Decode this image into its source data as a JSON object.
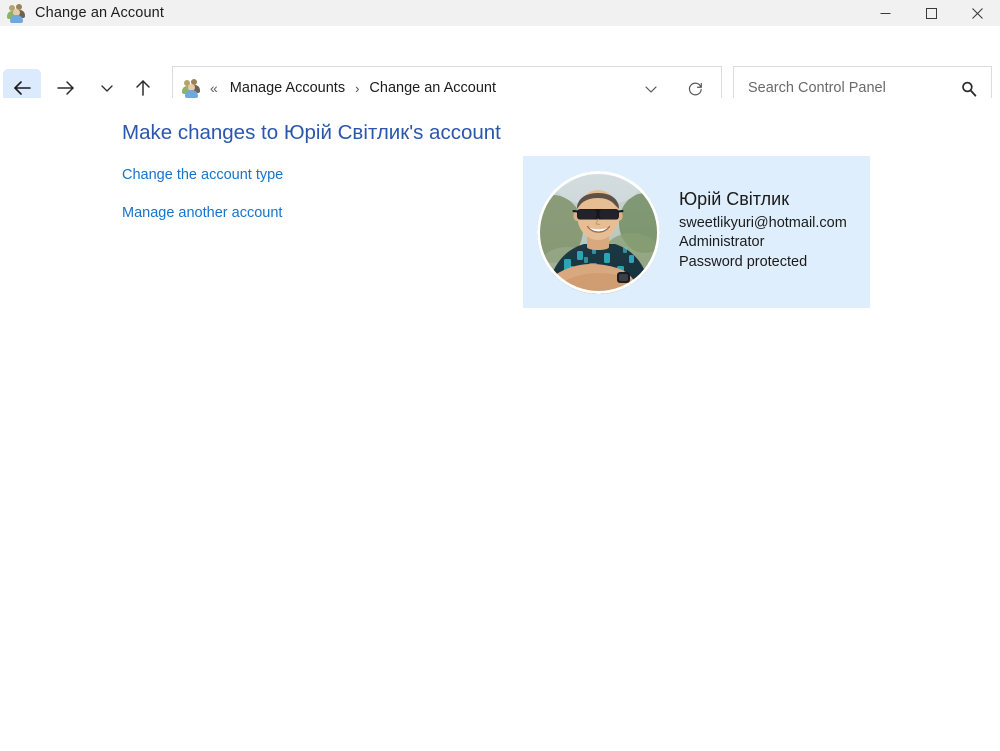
{
  "window": {
    "title": "Change an Account",
    "icon": "user-accounts-icon",
    "minimize_label": "–",
    "maximize_label": "□",
    "close_label": "✕"
  },
  "navigation": {
    "back_label": "←",
    "forward_label": "→",
    "recent_label": "⌄",
    "up_label": "↑",
    "address": {
      "icon": "user-accounts-icon",
      "leading_separator": "«",
      "crumbs": [
        {
          "label": "Manage Accounts"
        },
        {
          "label": "Change an Account"
        }
      ],
      "crumb_separator": "›",
      "dropdown_label": "⌄",
      "refresh_label": "⟳"
    },
    "search": {
      "placeholder": "Search Control Panel",
      "value": "",
      "icon": "search-icon"
    }
  },
  "content": {
    "heading": "Make changes to Юрій Світлик's account",
    "links": [
      {
        "label": "Change the account type"
      },
      {
        "label": "Manage another account"
      }
    ],
    "account": {
      "avatar_alt": "user-photo",
      "name": "Юрій Світлик",
      "email": "sweetlikyuri@hotmail.com",
      "account_type": "Administrator",
      "password_status": "Password protected"
    }
  },
  "colors": {
    "titlebar_bg": "#f1f1f1",
    "heading_blue": "#2b56ae",
    "link_blue": "#1774cb",
    "card_bg": "#deeefc",
    "back_btn_bg": "#dbeafc"
  }
}
